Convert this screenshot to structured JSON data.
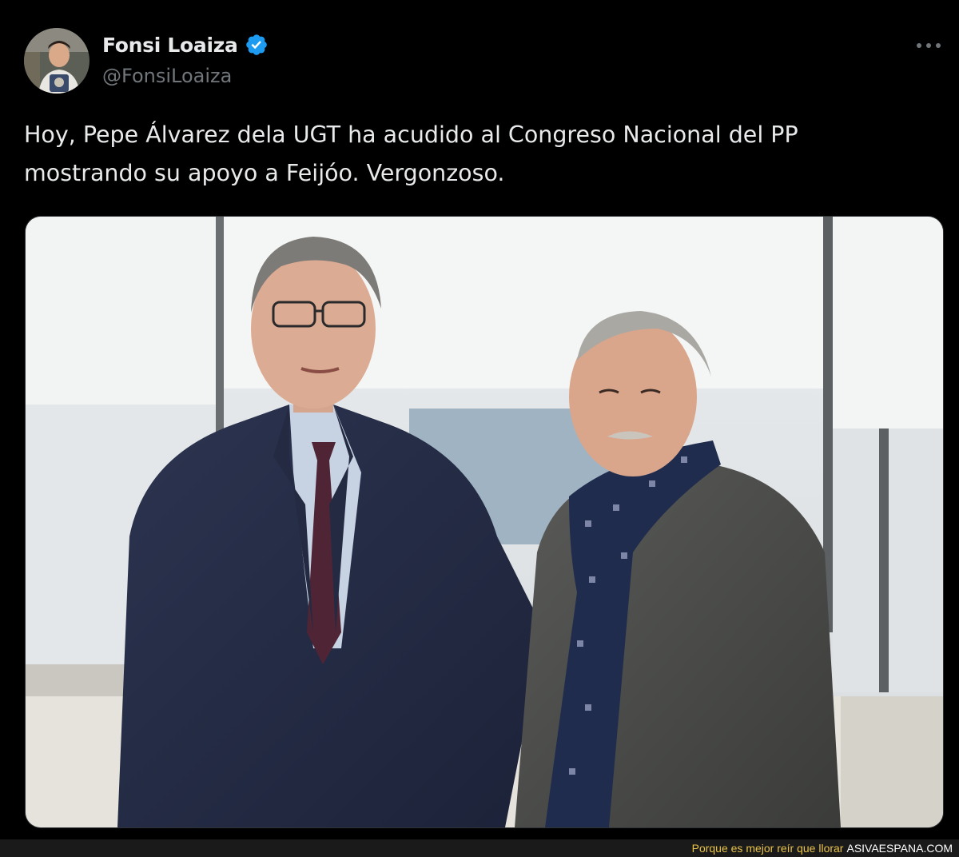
{
  "tweet": {
    "display_name": "Fonsi Loaiza",
    "handle": "@FonsiLoaiza",
    "verified": true,
    "text_lines": [
      "Hoy, Pepe Álvarez dela UGT ha acudido al Congreso Nacional del PP",
      "mostrando su apoyo a Feijóo. Vergonzoso."
    ],
    "icons": {
      "verified": "verified-badge-icon",
      "more": "more-options-icon"
    }
  },
  "watermark": {
    "slogan": "Porque es mejor reír que llorar",
    "site": "ASIVAESPANA.COM"
  },
  "colors": {
    "background": "#000000",
    "text_primary": "#e7e9ea",
    "text_secondary": "#71767b",
    "verified_blue": "#1d9bf0",
    "watermark_slogan": "#e8c24a",
    "watermark_site": "#ffffff"
  }
}
